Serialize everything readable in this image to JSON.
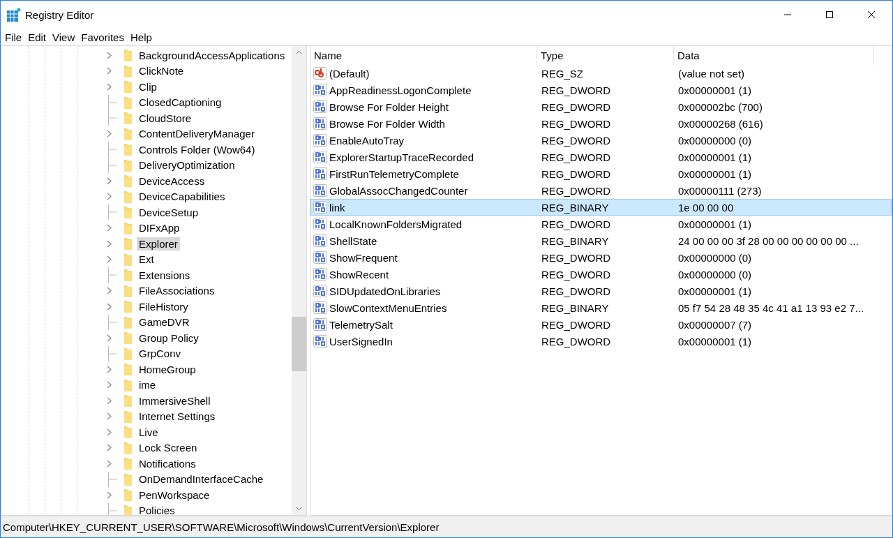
{
  "window": {
    "title": "Registry Editor"
  },
  "menu": [
    "File",
    "Edit",
    "View",
    "Favorites",
    "Help"
  ],
  "tree": {
    "items": [
      {
        "label": "BackgroundAccessApplications",
        "has_children": true,
        "selected": false
      },
      {
        "label": "ClickNote",
        "has_children": true,
        "selected": false
      },
      {
        "label": "Clip",
        "has_children": true,
        "selected": false
      },
      {
        "label": "ClosedCaptioning",
        "has_children": false,
        "selected": false
      },
      {
        "label": "CloudStore",
        "has_children": false,
        "selected": false
      },
      {
        "label": "ContentDeliveryManager",
        "has_children": true,
        "selected": false
      },
      {
        "label": "Controls Folder (Wow64)",
        "has_children": false,
        "selected": false
      },
      {
        "label": "DeliveryOptimization",
        "has_children": false,
        "selected": false
      },
      {
        "label": "DeviceAccess",
        "has_children": true,
        "selected": false
      },
      {
        "label": "DeviceCapabilities",
        "has_children": true,
        "selected": false
      },
      {
        "label": "DeviceSetup",
        "has_children": false,
        "selected": false
      },
      {
        "label": "DIFxApp",
        "has_children": true,
        "selected": false
      },
      {
        "label": "Explorer",
        "has_children": true,
        "selected": true
      },
      {
        "label": "Ext",
        "has_children": true,
        "selected": false
      },
      {
        "label": "Extensions",
        "has_children": false,
        "selected": false
      },
      {
        "label": "FileAssociations",
        "has_children": true,
        "selected": false
      },
      {
        "label": "FileHistory",
        "has_children": true,
        "selected": false
      },
      {
        "label": "GameDVR",
        "has_children": false,
        "selected": false
      },
      {
        "label": "Group Policy",
        "has_children": true,
        "selected": false
      },
      {
        "label": "GrpConv",
        "has_children": false,
        "selected": false
      },
      {
        "label": "HomeGroup",
        "has_children": true,
        "selected": false
      },
      {
        "label": "ime",
        "has_children": true,
        "selected": false
      },
      {
        "label": "ImmersiveShell",
        "has_children": true,
        "selected": false
      },
      {
        "label": "Internet Settings",
        "has_children": true,
        "selected": false
      },
      {
        "label": "Live",
        "has_children": true,
        "selected": false
      },
      {
        "label": "Lock Screen",
        "has_children": true,
        "selected": false
      },
      {
        "label": "Notifications",
        "has_children": true,
        "selected": false
      },
      {
        "label": "OnDemandInterfaceCache",
        "has_children": false,
        "selected": false
      },
      {
        "label": "PenWorkspace",
        "has_children": true,
        "selected": false
      },
      {
        "label": "Policies",
        "has_children": false,
        "selected": false
      }
    ]
  },
  "table": {
    "columns": [
      "Name",
      "Type",
      "Data"
    ],
    "rows": [
      {
        "kind": "string",
        "name": "(Default)",
        "type": "REG_SZ",
        "data": "(value not set)",
        "selected": false
      },
      {
        "kind": "binary",
        "name": "AppReadinessLogonComplete",
        "type": "REG_DWORD",
        "data": "0x00000001 (1)",
        "selected": false
      },
      {
        "kind": "binary",
        "name": "Browse For Folder Height",
        "type": "REG_DWORD",
        "data": "0x000002bc (700)",
        "selected": false
      },
      {
        "kind": "binary",
        "name": "Browse For Folder Width",
        "type": "REG_DWORD",
        "data": "0x00000268 (616)",
        "selected": false
      },
      {
        "kind": "binary",
        "name": "EnableAutoTray",
        "type": "REG_DWORD",
        "data": "0x00000000 (0)",
        "selected": false
      },
      {
        "kind": "binary",
        "name": "ExplorerStartupTraceRecorded",
        "type": "REG_DWORD",
        "data": "0x00000001 (1)",
        "selected": false
      },
      {
        "kind": "binary",
        "name": "FirstRunTelemetryComplete",
        "type": "REG_DWORD",
        "data": "0x00000001 (1)",
        "selected": false
      },
      {
        "kind": "binary",
        "name": "GlobalAssocChangedCounter",
        "type": "REG_DWORD",
        "data": "0x00000111 (273)",
        "selected": false
      },
      {
        "kind": "binary",
        "name": "link",
        "type": "REG_BINARY",
        "data": "1e 00 00 00",
        "selected": true
      },
      {
        "kind": "binary",
        "name": "LocalKnownFoldersMigrated",
        "type": "REG_DWORD",
        "data": "0x00000001 (1)",
        "selected": false
      },
      {
        "kind": "binary",
        "name": "ShellState",
        "type": "REG_BINARY",
        "data": "24 00 00 00 3f 28 00 00 00 00 00 00 ...",
        "selected": false
      },
      {
        "kind": "binary",
        "name": "ShowFrequent",
        "type": "REG_DWORD",
        "data": "0x00000000 (0)",
        "selected": false
      },
      {
        "kind": "binary",
        "name": "ShowRecent",
        "type": "REG_DWORD",
        "data": "0x00000000 (0)",
        "selected": false
      },
      {
        "kind": "binary",
        "name": "SIDUpdatedOnLibraries",
        "type": "REG_DWORD",
        "data": "0x00000001 (1)",
        "selected": false
      },
      {
        "kind": "binary",
        "name": "SlowContextMenuEntries",
        "type": "REG_BINARY",
        "data": "05 f7 54 28 48 35 4c 41 a1 13 93 e2 7...",
        "selected": false
      },
      {
        "kind": "binary",
        "name": "TelemetrySalt",
        "type": "REG_DWORD",
        "data": "0x00000007 (7)",
        "selected": false
      },
      {
        "kind": "binary",
        "name": "UserSignedIn",
        "type": "REG_DWORD",
        "data": "0x00000001 (1)",
        "selected": false
      }
    ]
  },
  "status_bar": "Computer\\HKEY_CURRENT_USER\\SOFTWARE\\Microsoft\\Windows\\CurrentVersion\\Explorer"
}
